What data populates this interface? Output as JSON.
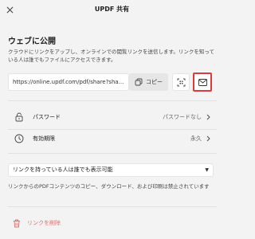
{
  "dialog": {
    "title": "UPDF 共有"
  },
  "share": {
    "section_title": "ウェブに公開",
    "description": "クラウドにリンクをアップし、オンラインでの閲覧リンクを送信します。リンクを知っている人は誰でもファイルにアクセスできます。",
    "link_value": "https://online.updf.com/pdf/share?sha...",
    "copy_label": "コピー"
  },
  "settings": [
    {
      "label": "パスワード",
      "value": "パスワードなし",
      "icon": "lock-icon"
    },
    {
      "label": "有効期限",
      "value": "永久",
      "icon": "clock-icon"
    }
  ],
  "permission": {
    "selected": "リンクを持っている人は誰でも表示可能",
    "note": "リンクからのPDFコンテンツのコピー、ダウンロード、および印刷は禁止されています"
  },
  "delete": {
    "label": "リンクを削除"
  },
  "colors": {
    "highlight": "#e0393a",
    "danger_text": "#e36b6b"
  }
}
